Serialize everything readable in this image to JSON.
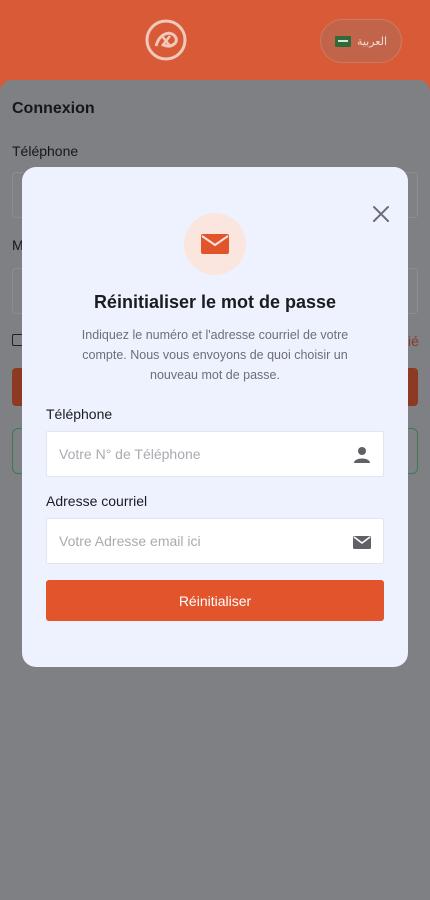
{
  "header": {
    "language_label": "العربية",
    "flag_icon": "saudi-flag-icon",
    "logo_icon": "brand-logo-icon"
  },
  "background": {
    "login_title": "Connexion",
    "phone_label": "Téléphone",
    "password_label_fragment": "M",
    "forgot_fragment": "ié"
  },
  "modal": {
    "icon": "envelope-icon",
    "title": "Réinitialiser le mot de passe",
    "description": "Indiquez le numéro et l'adresse courriel de votre compte. Nous vous envoyons de quoi choisir un nouveau mot de passe.",
    "phone": {
      "label": "Téléphone",
      "placeholder": "Votre N° de Téléphone",
      "value": "",
      "icon": "user-icon"
    },
    "email": {
      "label": "Adresse courriel",
      "placeholder": "Votre Adresse email ici",
      "value": "",
      "icon": "envelope-icon"
    },
    "submit_label": "Réinitialiser",
    "close_icon": "close-icon"
  },
  "colors": {
    "accent": "#e2542c",
    "header_bg": "#d95a37",
    "modal_bg": "#eef2ff",
    "overlay": "#7d7f84"
  }
}
